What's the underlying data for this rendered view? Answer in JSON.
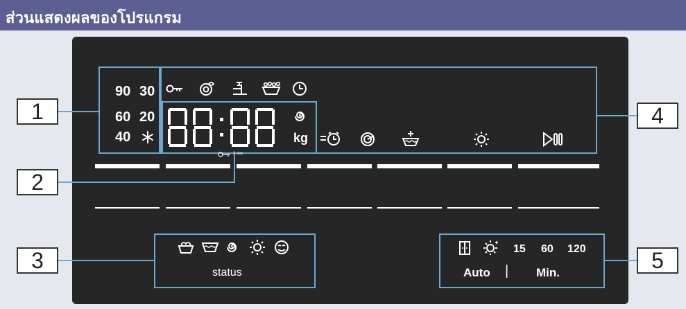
{
  "header": {
    "title": "ส่วนแสดงผลของโปรแกรม"
  },
  "callouts": {
    "c1": "1",
    "c2": "2",
    "c3": "3",
    "c4": "4",
    "c5": "5"
  },
  "temperature": {
    "t90": "90",
    "t30": "30",
    "t60": "60",
    "t20": "20",
    "t40": "40"
  },
  "display": {
    "kg_label": "kg",
    "lock_hint": "3 sec"
  },
  "status_section": {
    "label": "status"
  },
  "time_section": {
    "v15": "15",
    "v60": "60",
    "v120": "120",
    "auto": "Auto",
    "sep": "|",
    "min": "Min."
  },
  "icons": [
    "key-lock-icon",
    "stain-icon",
    "tap-icon",
    "prewash-icon",
    "timer-icon",
    "spin-spiral-icon",
    "snowflake-icon",
    "finish-timer-icon",
    "drum-clean-icon",
    "extra-rinse-icon",
    "drying-sun-icon",
    "start-pause-icon",
    "wash-status-icon",
    "rinse-status-icon",
    "spin-status-icon",
    "dry-status-icon",
    "end-status-icon",
    "cupboard-dry-icon",
    "time-dry-icon"
  ],
  "colors": {
    "header_bg": "#5d5f92",
    "panel_bg": "#262626",
    "accent_outline": "#6aa8d2",
    "page_bg": "#e6e8ef"
  }
}
